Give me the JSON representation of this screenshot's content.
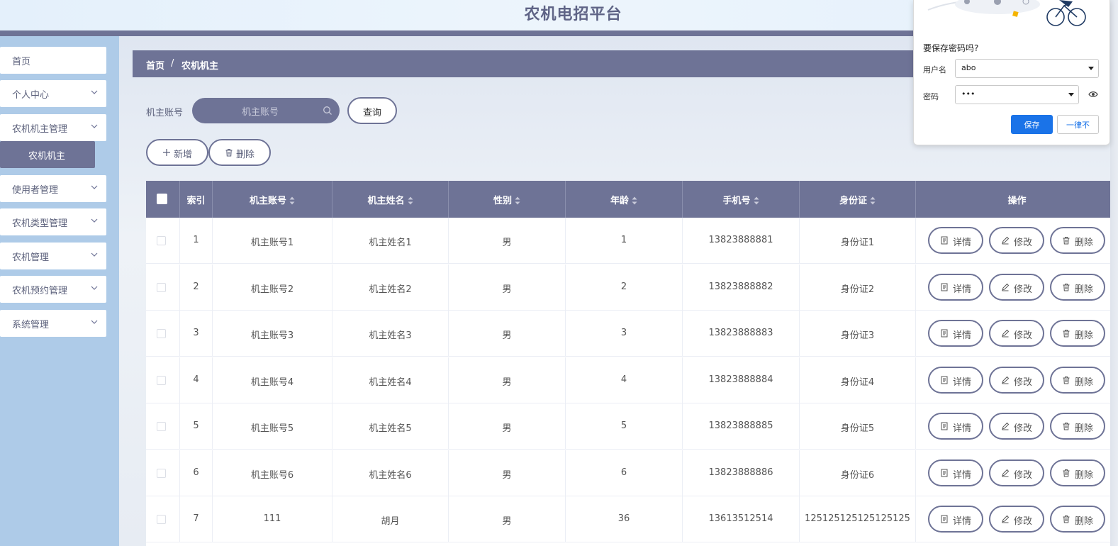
{
  "app": {
    "title": "农机电招平台"
  },
  "colors": {
    "primary": "#6e7396",
    "sidebar_bg": "#aecbe8",
    "accent_blue": "#1a73e8"
  },
  "sidebar": {
    "items": [
      {
        "label": "首页",
        "has_children": false
      },
      {
        "label": "个人中心",
        "has_children": true
      },
      {
        "label": "农机机主管理",
        "has_children": true,
        "expanded": true
      },
      {
        "label": "使用者管理",
        "has_children": true
      },
      {
        "label": "农机类型管理",
        "has_children": true
      },
      {
        "label": "农机管理",
        "has_children": true
      },
      {
        "label": "农机预约管理",
        "has_children": true
      },
      {
        "label": "系统管理",
        "has_children": true
      }
    ],
    "active_sub": {
      "label": "农机机主"
    }
  },
  "breadcrumb": {
    "home": "首页",
    "sep": "/",
    "current": "农机机主"
  },
  "search": {
    "label": "机主账号",
    "placeholder": "机主账号",
    "button": "查询"
  },
  "toolbar": {
    "add_label": "新增",
    "delete_label": "删除"
  },
  "table": {
    "columns": [
      "索引",
      "机主账号",
      "机主姓名",
      "性别",
      "年龄",
      "手机号",
      "身份证",
      "操作"
    ],
    "rows": [
      {
        "index": "1",
        "account": "机主账号1",
        "name": "机主姓名1",
        "gender": "男",
        "age": "1",
        "phone": "13823888881",
        "idcard": "身份证1"
      },
      {
        "index": "2",
        "account": "机主账号2",
        "name": "机主姓名2",
        "gender": "男",
        "age": "2",
        "phone": "13823888882",
        "idcard": "身份证2"
      },
      {
        "index": "3",
        "account": "机主账号3",
        "name": "机主姓名3",
        "gender": "男",
        "age": "3",
        "phone": "13823888883",
        "idcard": "身份证3"
      },
      {
        "index": "4",
        "account": "机主账号4",
        "name": "机主姓名4",
        "gender": "男",
        "age": "4",
        "phone": "13823888884",
        "idcard": "身份证4"
      },
      {
        "index": "5",
        "account": "机主账号5",
        "name": "机主姓名5",
        "gender": "男",
        "age": "5",
        "phone": "13823888885",
        "idcard": "身份证5"
      },
      {
        "index": "6",
        "account": "机主账号6",
        "name": "机主姓名6",
        "gender": "男",
        "age": "6",
        "phone": "13823888886",
        "idcard": "身份证6"
      },
      {
        "index": "7",
        "account": "111",
        "name": "胡月",
        "gender": "男",
        "age": "36",
        "phone": "13613512514",
        "idcard": "125125125125125125"
      }
    ],
    "actions": {
      "detail": "详情",
      "edit": "修改",
      "delete": "删除"
    }
  },
  "password_popup": {
    "title": "要保存密码吗?",
    "username_label": "用户名",
    "username_value": "abo",
    "password_label": "密码",
    "password_value": "•••",
    "save_label": "保存",
    "never_label": "一律不"
  }
}
